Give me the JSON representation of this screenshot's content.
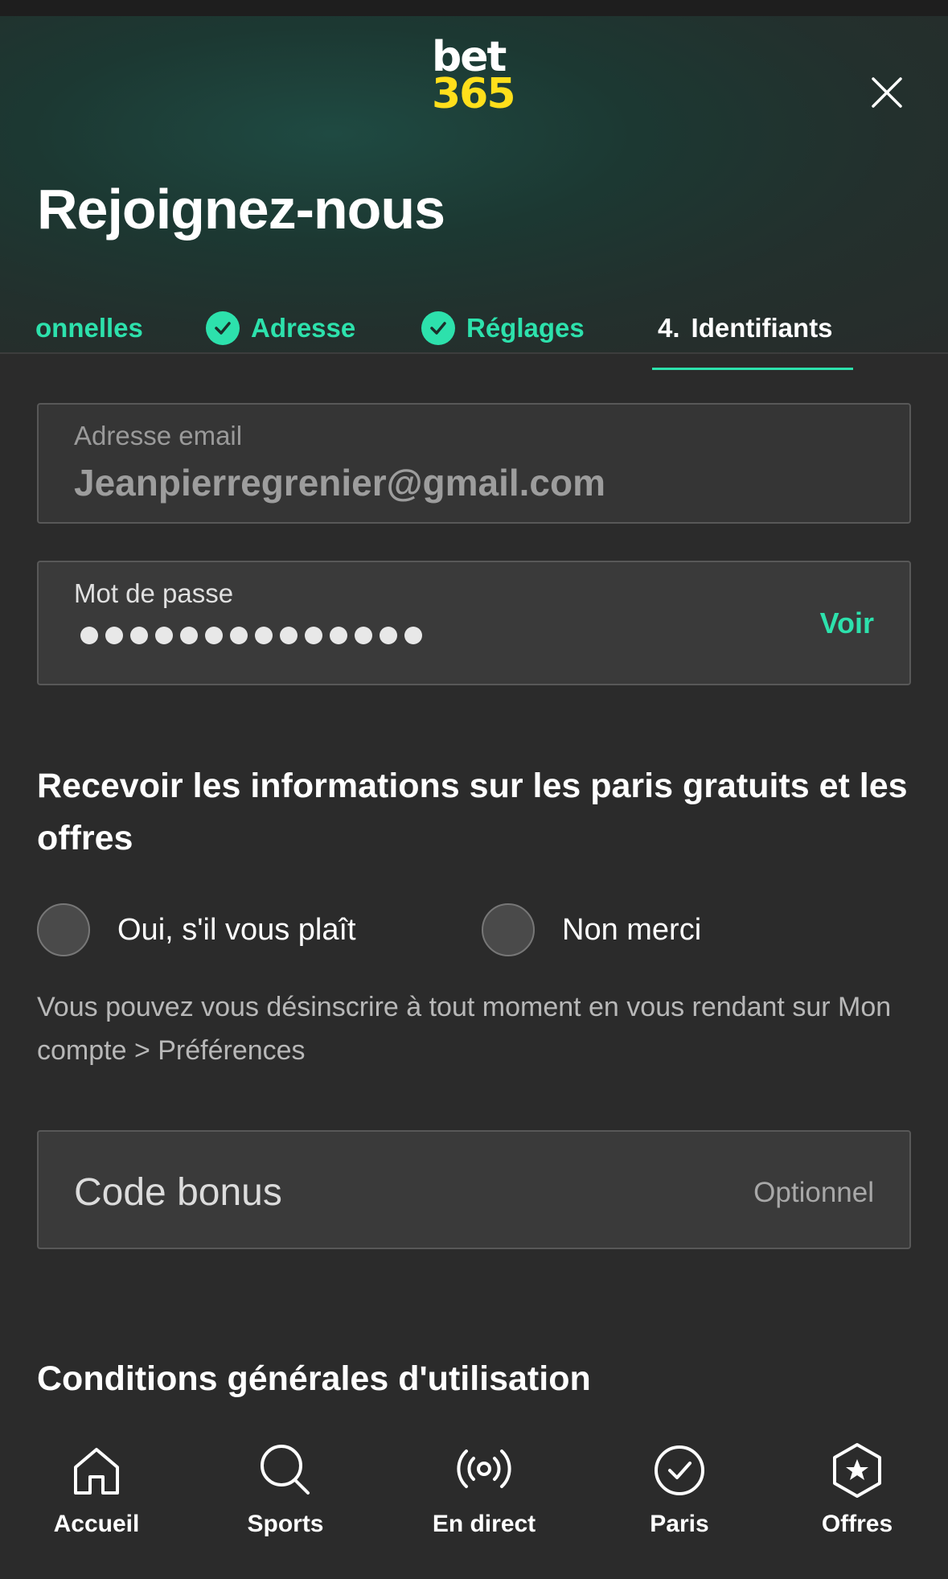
{
  "header": {
    "logo_top": "bet",
    "logo_bottom": "365",
    "title": "Rejoignez-nous"
  },
  "steps": [
    {
      "label": "onnelles",
      "state": "done"
    },
    {
      "label": "Adresse",
      "state": "done"
    },
    {
      "label": "Réglages",
      "state": "done"
    },
    {
      "number": "4.",
      "label": "Identifiants",
      "state": "active"
    }
  ],
  "email": {
    "label": "Adresse email",
    "value": "Jeanpierregrenier@gmail.com"
  },
  "password": {
    "label": "Mot de passe",
    "masked_length": 14,
    "toggle_label": "Voir"
  },
  "marketing": {
    "title": "Recevoir les informations sur les paris gratuits et les offres",
    "option_yes": "Oui, s'il vous plaît",
    "option_no": "Non merci",
    "note": "Vous pouvez vous désinscrire à tout moment en vous rendant sur Mon compte > Préférences"
  },
  "bonus": {
    "placeholder": "Code bonus",
    "hint": "Optionnel"
  },
  "terms": {
    "title": "Conditions générales d'utilisation"
  },
  "nav": [
    {
      "label": "Accueil",
      "icon": "home-icon"
    },
    {
      "label": "Sports",
      "icon": "search-icon"
    },
    {
      "label": "En direct",
      "icon": "broadcast-icon"
    },
    {
      "label": "Paris",
      "icon": "check-circle-icon"
    },
    {
      "label": "Offres",
      "icon": "offers-star-icon"
    }
  ],
  "colors": {
    "accent": "#2de1ac",
    "logo_yellow": "#ffdf1b",
    "background": "#2b2b2b"
  }
}
